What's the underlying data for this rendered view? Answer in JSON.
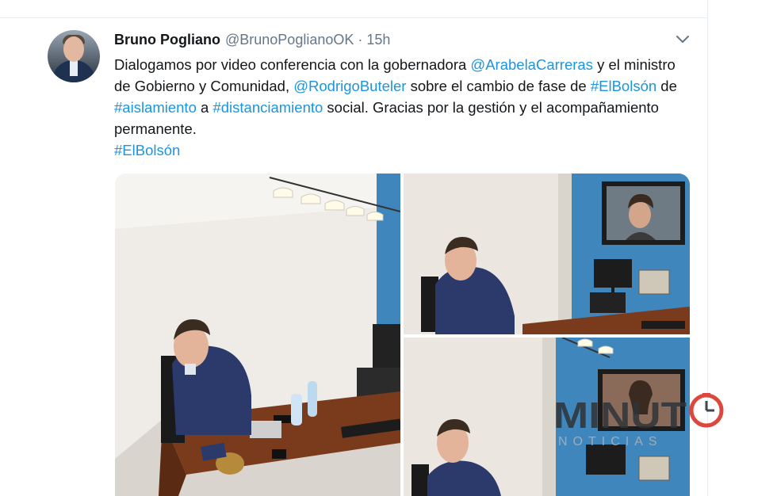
{
  "tweet": {
    "author": {
      "name": "Bruno Pogliano",
      "handle": "@BrunoPoglianoOK",
      "separator": "·",
      "time": "15h"
    },
    "text": {
      "p1": "Dialogamos por video conferencia con la gobernadora ",
      "mention1": "@ArabelaCarreras",
      "p2": " y el ministro de Gobierno y Comunidad, ",
      "mention2": "@RodrigoButeler",
      "p3": " sobre el cambio de fase de ",
      "hashtag1": "#ElBolsón",
      "p4": " de ",
      "hashtag2": "#aislamiento",
      "p5": " a ",
      "hashtag3": "#distanciamiento",
      "p6": " social. Gracias por la gestión y el acompañamiento permanente.",
      "hashtag4": "#ElBolsón"
    }
  },
  "icons": {
    "menu": "chevron-down-icon",
    "clock": "clock-icon"
  },
  "watermark": {
    "word_prefix": "MINUT",
    "word_suffix": "NOTICIAS"
  },
  "colors": {
    "link": "#1b95e0",
    "secondary_text": "#657786",
    "wall_blue": "#3f86bd",
    "watermark_dark": "#2f3338",
    "watermark_red": "#d9352a"
  }
}
